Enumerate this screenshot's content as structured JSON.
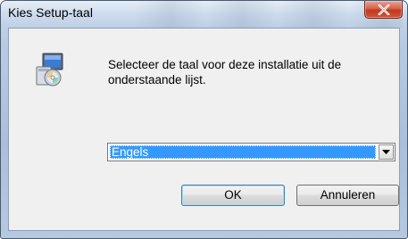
{
  "window": {
    "title": "Kies Setup-taal",
    "close_icon": "close-icon"
  },
  "dialog": {
    "icon": "installer-icon",
    "prompt": "Selecteer de taal voor deze installatie uit de onderstaande lijst.",
    "language_select": {
      "selected": "Engels",
      "arrow_icon": "chevron-down-icon"
    },
    "buttons": {
      "ok": "OK",
      "cancel": "Annuleren"
    }
  },
  "colors": {
    "selection": "#3399ff",
    "close_button": "#c74a33",
    "frame": "#b7cbe3"
  }
}
